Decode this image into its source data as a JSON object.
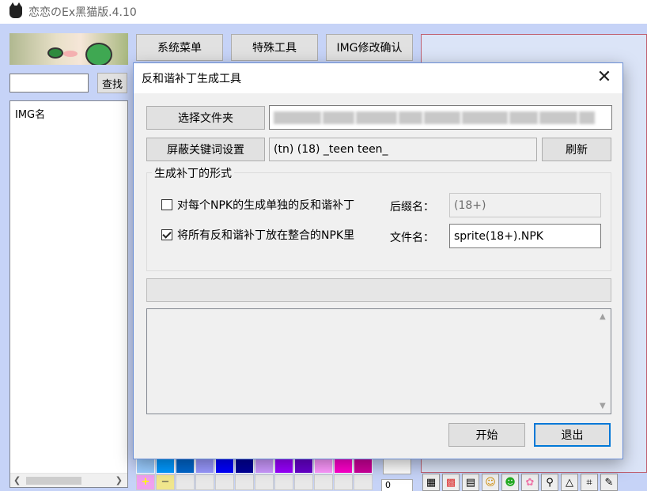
{
  "app": {
    "title": "恋恋のEx黑猫版.4.10"
  },
  "left_panel": {
    "search_value": "",
    "search_button": "查找",
    "list_header": "IMG名"
  },
  "tabs": [
    "系统菜单",
    "特殊工具",
    "IMG修改确认"
  ],
  "palette": {
    "colors": [
      "#99ccff",
      "#0099ff",
      "#0066cc",
      "#9999ff",
      "#0000ff",
      "#000099",
      "#cc99ff",
      "#9900ff",
      "#6600cc",
      "#ff99ff",
      "#ff00cc",
      "#cc0099"
    ]
  },
  "zoom_value": "0",
  "dialog": {
    "title": "反和谐补丁生成工具",
    "select_folder_button": "选择文件夹",
    "folder_path": "",
    "keyword_button": "屏蔽关键词设置",
    "keywords": "(tn) (18) _teen teen_",
    "refresh_button": "刷新",
    "group_title": "生成补丁的形式",
    "option_each": {
      "label": "对每个NPK的生成单独的反和谐补丁",
      "checked": false
    },
    "option_merge": {
      "label": "将所有反和谐补丁放在整合的NPK里",
      "checked": true
    },
    "suffix_label": "后缀名：",
    "suffix_value": "(18+)",
    "filename_label": "文件名：",
    "filename_value": "sprite(18+).NPK",
    "progress": 0,
    "log": "",
    "start_button": "开始",
    "exit_button": "退出"
  }
}
